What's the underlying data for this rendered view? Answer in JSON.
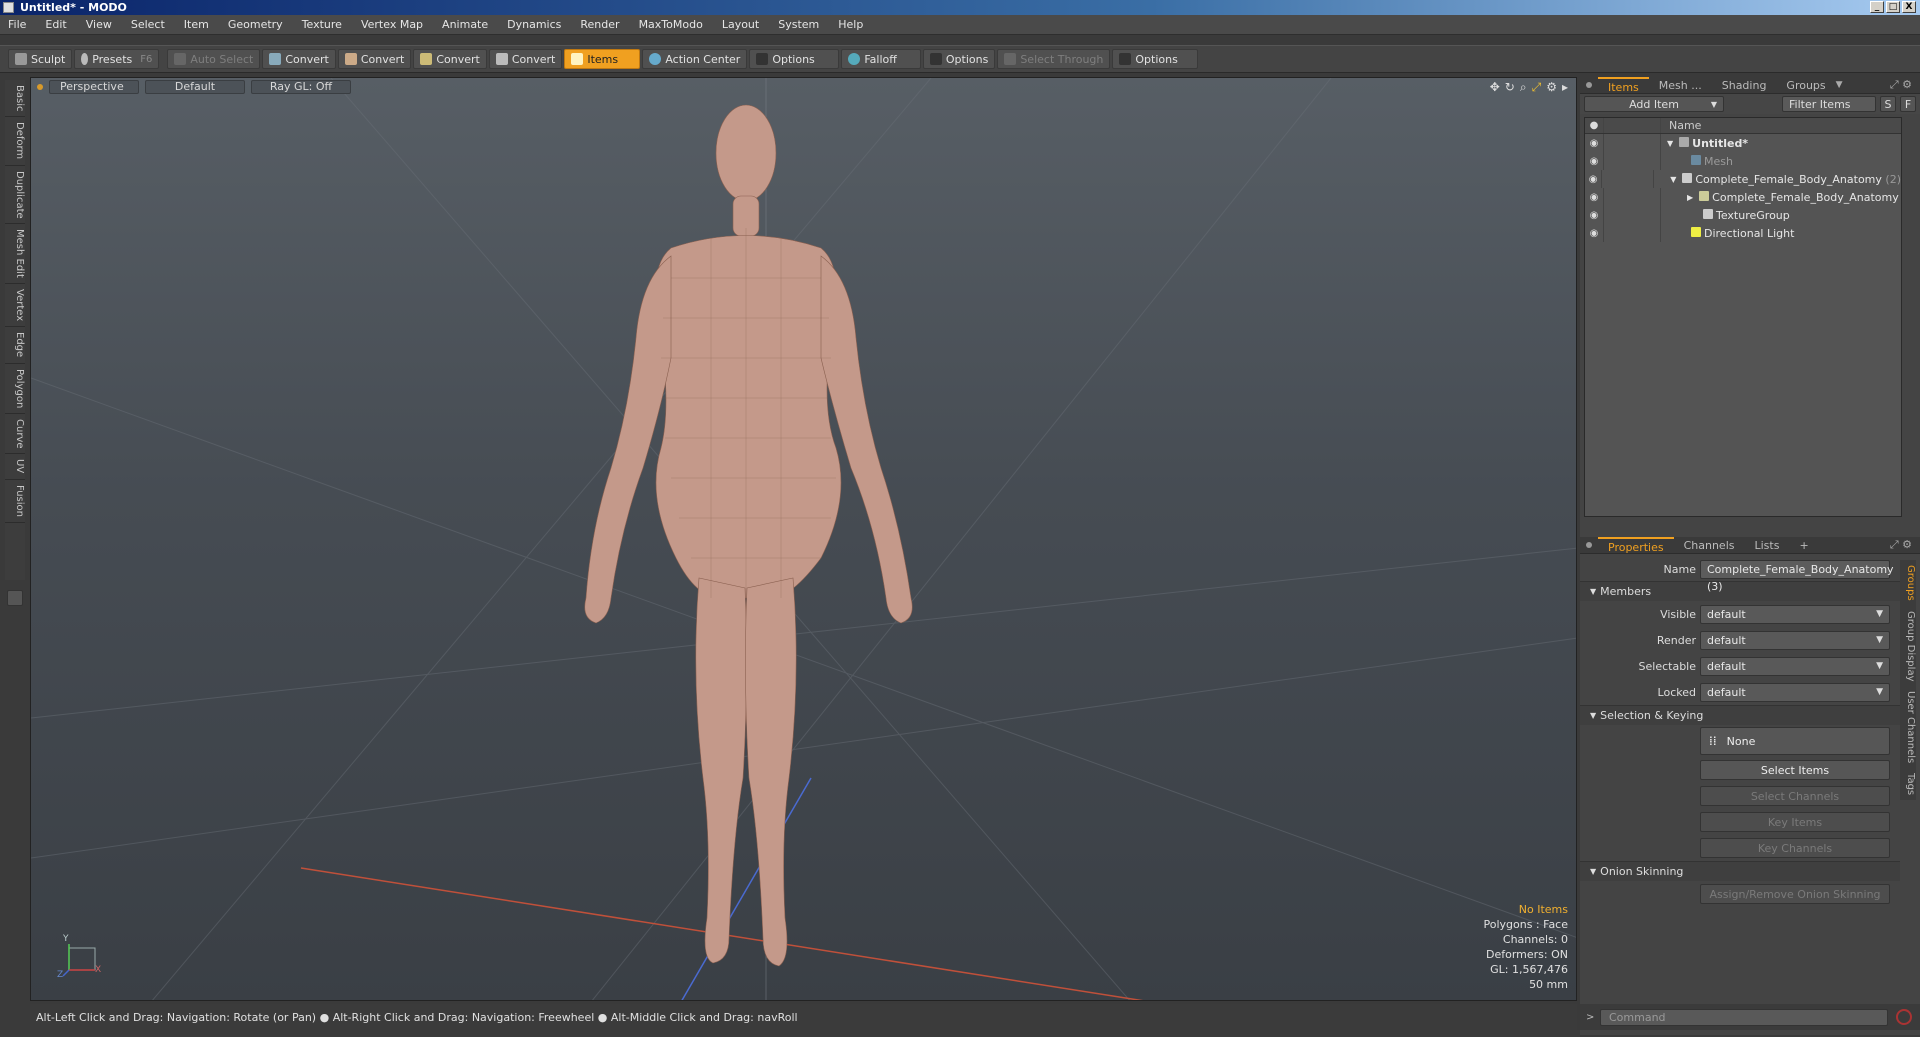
{
  "window": {
    "title": "Untitled* - MODO",
    "buttons": [
      "_",
      "□",
      "X"
    ]
  },
  "menu": [
    "File",
    "Edit",
    "View",
    "Select",
    "Item",
    "Geometry",
    "Texture",
    "Vertex Map",
    "Animate",
    "Dynamics",
    "Render",
    "MaxToModo",
    "Layout",
    "System",
    "Help"
  ],
  "toolbar": {
    "sculpt": "Sculpt",
    "presets": "Presets",
    "presets_key": "F6",
    "auto_select": "Auto Select",
    "convert1": "Convert",
    "convert2": "Convert",
    "convert3": "Convert",
    "convert4": "Convert",
    "items": "Items",
    "action_center": "Action Center",
    "options1": "Options",
    "falloff": "Falloff",
    "options2": "Options",
    "select_through": "Select Through",
    "options3": "Options"
  },
  "left_tabs": [
    "Basic",
    "Deform",
    "Duplicate",
    "Mesh Edit",
    "Vertex",
    "Edge",
    "Polygon",
    "Curve",
    "UV",
    "Fusion"
  ],
  "viewport": {
    "view": "Perspective",
    "shading": "Default",
    "raygl": "Ray GL: Off",
    "stats": {
      "no_items": "No Items",
      "polygons": "Polygons : Face",
      "channels": "Channels: 0",
      "deformers": "Deformers: ON",
      "gl": "GL: 1,567,476",
      "lens": "50 mm"
    },
    "axis": {
      "y": "Y",
      "x": "X",
      "z": "Z"
    }
  },
  "status": "Alt-Left Click and Drag: Navigation: Rotate (or Pan) ● Alt-Right Click and Drag: Navigation: Freewheel ● Alt-Middle Click and Drag: navRoll",
  "items_panel": {
    "tabs": [
      "Items",
      "Mesh ...",
      "Shading",
      "Groups"
    ],
    "add_item": "Add Item",
    "filter_items": "Filter Items",
    "s_btn": "S",
    "f_btn": "F",
    "name_header": "Name",
    "rows": [
      {
        "name": "Untitled*",
        "count": ""
      },
      {
        "name": "Mesh",
        "count": ""
      },
      {
        "name": "Complete_Female_Body_Anatomy",
        "count": "(2)"
      },
      {
        "name": "Complete_Female_Body_Anatomy",
        "count": ""
      },
      {
        "name": "TextureGroup",
        "count": ""
      },
      {
        "name": "Directional Light",
        "count": ""
      }
    ]
  },
  "properties": {
    "tabs": [
      "Properties",
      "Channels",
      "Lists",
      "+"
    ],
    "name_label": "Name",
    "name_value": "Complete_Female_Body_Anatomy (3)",
    "members": "Members",
    "visible_label": "Visible",
    "visible_value": "default",
    "render_label": "Render",
    "render_value": "default",
    "selectable_label": "Selectable",
    "selectable_value": "default",
    "locked_label": "Locked",
    "locked_value": "default",
    "selection_keying": "Selection & Keying",
    "none_btn": "None",
    "select_items": "Select Items",
    "select_channels": "Select Channels",
    "key_items": "Key Items",
    "key_channels": "Key Channels",
    "onion_skinning": "Onion Skinning",
    "assign_onion": "Assign/Remove Onion Skinning",
    "side_tabs": [
      "Groups",
      "Group Display",
      "User Channels",
      "Tags"
    ]
  },
  "command": {
    "placeholder": "Command"
  },
  "colors": {
    "accent": "#f0a020",
    "viewport_top": "#575e65",
    "viewport_bottom": "#3a3f45"
  }
}
